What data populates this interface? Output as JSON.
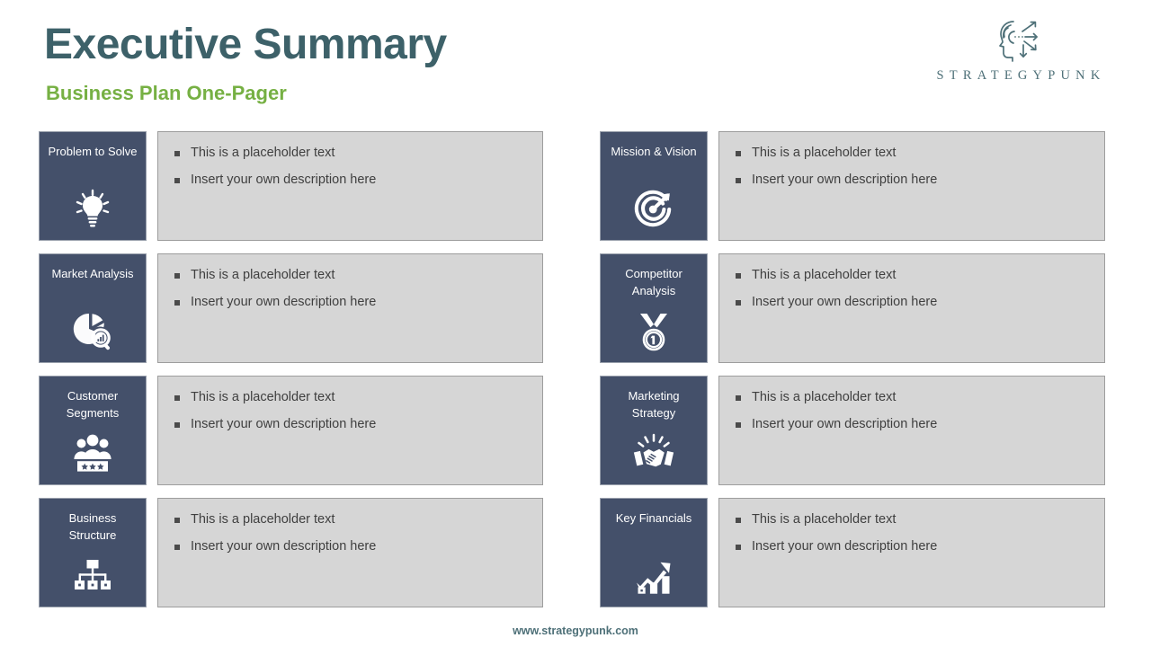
{
  "header": {
    "title": "Executive Summary",
    "subtitle": "Business Plan One-Pager",
    "logo": {
      "icon_name": "strategypunk-head-arrows-logo",
      "wordmark": "STRATEGYPUNK"
    }
  },
  "colors": {
    "title": "#3d6169",
    "subtitle": "#76b043",
    "tile_background": "#44506a",
    "tile_border": "#9aa1ad",
    "panel_background": "#d6d6d6",
    "panel_border": "#9d9d9d",
    "bullet_text": "#3f3f3f",
    "brand": "#4e7078",
    "page_background": "#ffffff"
  },
  "blocks": [
    {
      "id": "problem-to-solve",
      "label": "Problem to Solve",
      "icon": "lightbulb-icon",
      "column": "left",
      "row": 1,
      "bullets": [
        "This is a placeholder text",
        "Insert your own description here"
      ]
    },
    {
      "id": "market-analysis",
      "label": "Market Analysis",
      "icon": "pie-chart-magnifier-icon",
      "column": "left",
      "row": 2,
      "bullets": [
        "This is a placeholder text",
        "Insert your own description here"
      ]
    },
    {
      "id": "customer-segments",
      "label": "Customer Segments",
      "icon": "people-group-stars-icon",
      "column": "left",
      "row": 3,
      "bullets": [
        "This is a placeholder text",
        "Insert your own description here"
      ]
    },
    {
      "id": "business-structure",
      "label": "Business Structure",
      "icon": "org-chart-icon",
      "column": "left",
      "row": 4,
      "bullets": [
        "This is a placeholder text",
        "Insert your own description here"
      ]
    },
    {
      "id": "mission-and-vision",
      "label": "Mission & Vision",
      "icon": "target-arrow-icon",
      "column": "right",
      "row": 1,
      "bullets": [
        "This is a placeholder text",
        "Insert your own description here"
      ]
    },
    {
      "id": "competitor-analysis",
      "label": "Competitor Analysis",
      "icon": "medal-number-one-icon",
      "column": "right",
      "row": 2,
      "bullets": [
        "This is a placeholder text",
        "Insert your own description here"
      ]
    },
    {
      "id": "marketing-strategy",
      "label": "Marketing Strategy",
      "icon": "handshake-icon",
      "column": "right",
      "row": 3,
      "bullets": [
        "This is a placeholder text",
        "Insert your own description here"
      ]
    },
    {
      "id": "key-financials",
      "label": "Key Financials",
      "icon": "growth-bar-chart-arrow-icon",
      "column": "right",
      "row": 4,
      "bullets": [
        "This is a placeholder text",
        "Insert your own description here"
      ]
    }
  ],
  "footer": {
    "url": "www.strategypunk.com"
  }
}
